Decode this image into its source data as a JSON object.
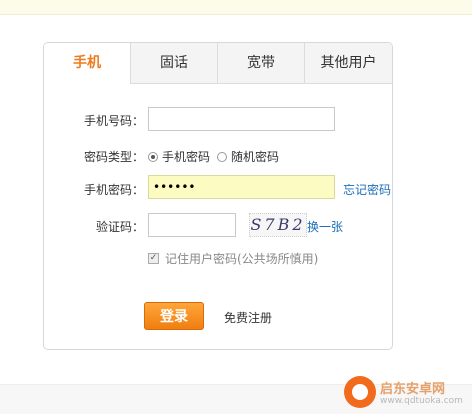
{
  "tabs": [
    {
      "label": "手机",
      "active": true
    },
    {
      "label": "固话",
      "active": false
    },
    {
      "label": "宽带",
      "active": false
    },
    {
      "label": "其他用户",
      "active": false
    }
  ],
  "form": {
    "phone_label": "手机号码：",
    "phone_value": "",
    "pwd_type_label": "密码类型：",
    "pwd_type_options": [
      "手机密码",
      "随机密码"
    ],
    "pwd_type_selected": "手机密码",
    "pwd_label": "手机密码：",
    "pwd_value": "••••••",
    "forgot_link": "忘记密码",
    "captcha_label": "验证码：",
    "captcha_value": "",
    "captcha_image_text": "S7B2",
    "refresh_link": "换一张",
    "remember_label": "记住用户密码(公共场所慎用)",
    "remember_checked": true,
    "login_button": "登录",
    "register_link": "免费注册"
  },
  "watermark": {
    "text": "启东安卓网",
    "url": "www.qdtuoka.com"
  },
  "colors": {
    "accent": "#ee7b1d",
    "link": "#1a6fb8",
    "password_fill": "#fbfbc2"
  }
}
